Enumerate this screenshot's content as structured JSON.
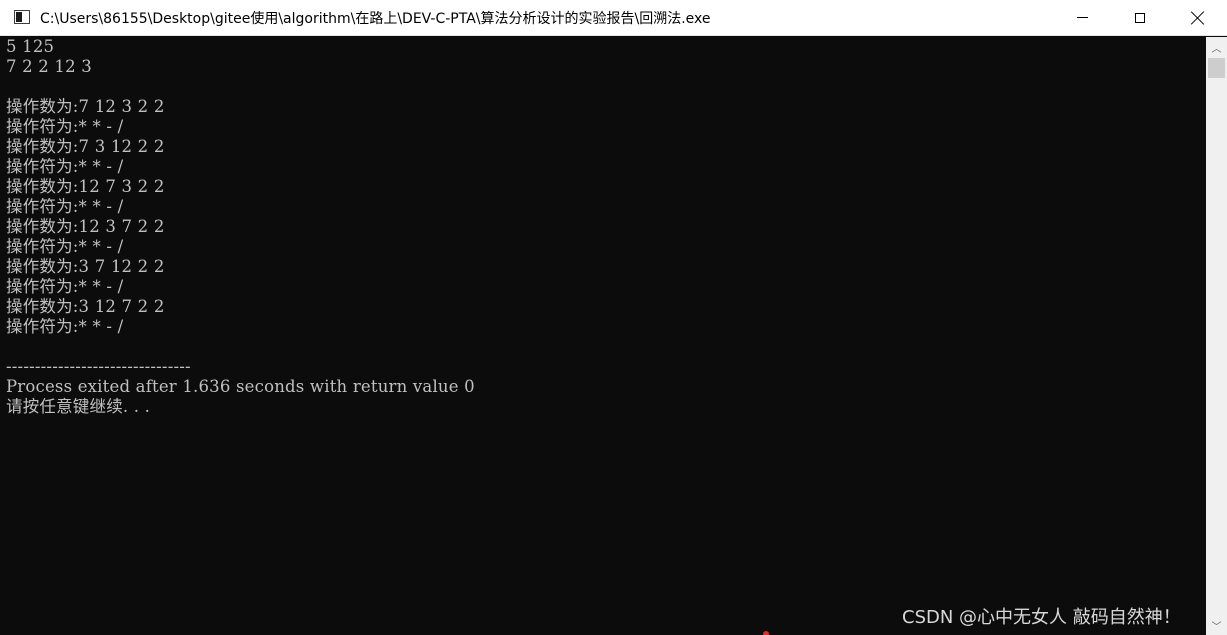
{
  "window": {
    "title": "C:\\Users\\86155\\Desktop\\gitee使用\\algorithm\\在路上\\DEV-C-PTA\\算法分析设计的实验报告\\回溯法.exe",
    "app_icon": "console-app-icon",
    "controls": {
      "minimize_icon": "minimize-icon",
      "maximize_icon": "maximize-icon",
      "close_icon": "close-icon"
    }
  },
  "console": {
    "background": "#0c0c0c",
    "foreground": "#c0c0c0",
    "lines": [
      "5 125",
      "7 2 2 12 3",
      "",
      "操作数为:7 12 3 2 2",
      "操作符为:* * - /",
      "操作数为:7 3 12 2 2",
      "操作符为:* * - /",
      "操作数为:12 7 3 2 2",
      "操作符为:* * - /",
      "操作数为:12 3 7 2 2",
      "操作符为:* * - /",
      "操作数为:3 7 12 2 2",
      "操作符为:* * - /",
      "操作数为:3 12 7 2 2",
      "操作符为:* * - /",
      "",
      "--------------------------------",
      "Process exited after 1.636 seconds with return value 0",
      "请按任意键继续. . ."
    ]
  },
  "scrollbar": {
    "up_icon": "scroll-up-arrow-icon",
    "down_icon": "scroll-down-arrow-icon"
  },
  "watermark": {
    "text": "CSDN @心中无女人 敲码自然神！"
  }
}
